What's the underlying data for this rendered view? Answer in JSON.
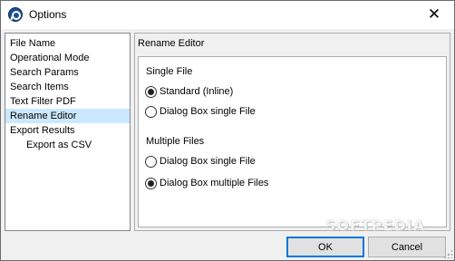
{
  "window": {
    "title": "Options",
    "close_glyph": "✕"
  },
  "nav": {
    "items": [
      {
        "label": "File Name"
      },
      {
        "label": "Operational Mode"
      },
      {
        "label": "Search Params"
      },
      {
        "label": "Search Items"
      },
      {
        "label": "Text Filter PDF"
      },
      {
        "label": "Rename Editor",
        "selected": true
      },
      {
        "label": "Export Results"
      },
      {
        "label": "Export as CSV",
        "sub": true
      }
    ]
  },
  "panel": {
    "title": "Rename Editor",
    "single_file": {
      "label": "Single File",
      "options": [
        {
          "label": "Standard (Inline)",
          "checked": true
        },
        {
          "label": "Dialog Box single File",
          "checked": false
        }
      ]
    },
    "multiple_files": {
      "label": "Multiple Files",
      "options": [
        {
          "label": "Dialog Box single File",
          "checked": false
        },
        {
          "label": "Dialog Box multiple Files",
          "checked": true
        }
      ]
    }
  },
  "buttons": {
    "ok": "OK",
    "cancel": "Cancel"
  },
  "watermark": "SOFTPEDIA",
  "icons": {
    "app": "options-app-icon",
    "close": "close-icon"
  }
}
